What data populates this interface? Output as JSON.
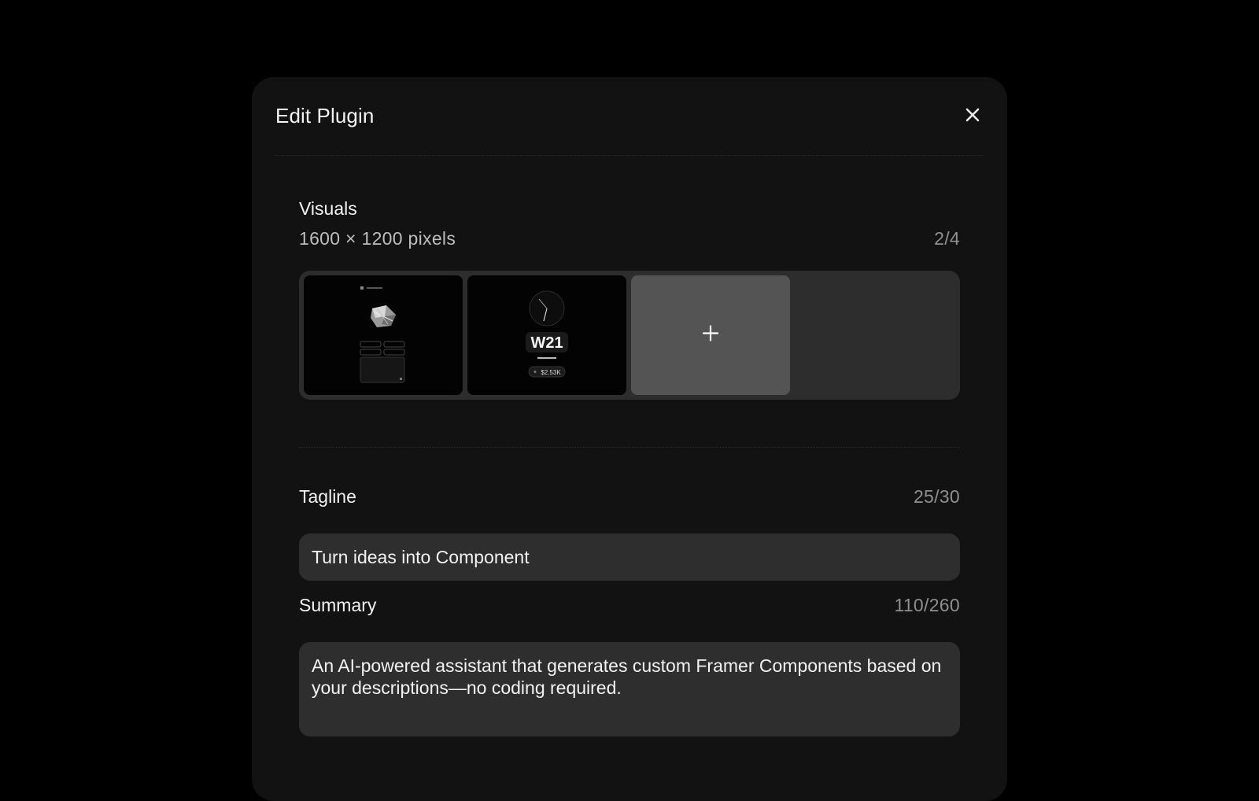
{
  "modal": {
    "title": "Edit Plugin",
    "close_icon": "close-icon"
  },
  "visuals": {
    "label": "Visuals",
    "dimensions": "1600 × 1200 pixels",
    "count": "2/4",
    "add_icon": "plus-icon",
    "thumbnails": [
      {
        "name": "screenshot-1"
      },
      {
        "name": "screenshot-2",
        "badge": "$2.53K"
      }
    ]
  },
  "tagline": {
    "label": "Tagline",
    "count": "25/30",
    "value": "Turn ideas into Component"
  },
  "summary": {
    "label": "Summary",
    "count": "110/260",
    "value": "An AI-powered assistant that generates custom Framer Components based on your descriptions—no coding required."
  },
  "colors": {
    "page_background": "#000000",
    "modal_background": "#121212",
    "input_background": "#2e2e2e",
    "add_slot": "#545454"
  }
}
